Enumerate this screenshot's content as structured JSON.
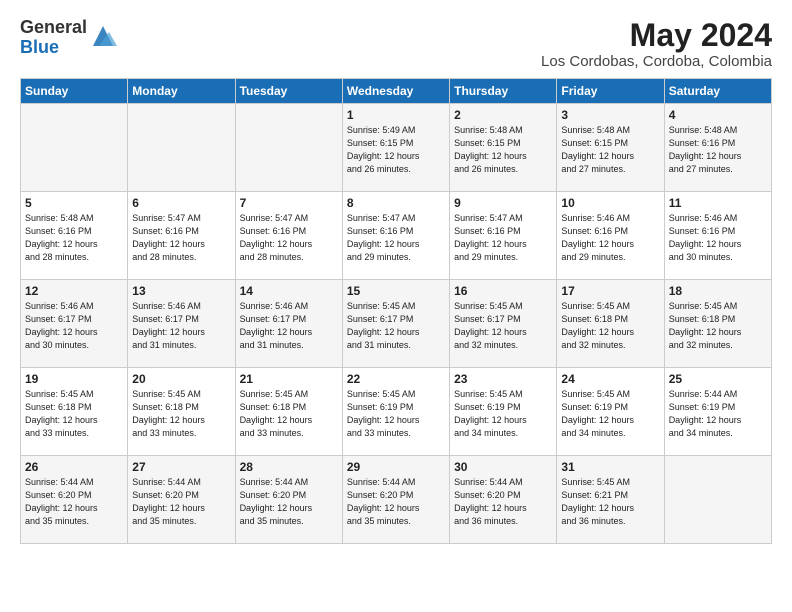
{
  "header": {
    "logo_general": "General",
    "logo_blue": "Blue",
    "month_year": "May 2024",
    "location": "Los Cordobas, Cordoba, Colombia"
  },
  "days_of_week": [
    "Sunday",
    "Monday",
    "Tuesday",
    "Wednesday",
    "Thursday",
    "Friday",
    "Saturday"
  ],
  "weeks": [
    [
      {
        "day": "",
        "info": ""
      },
      {
        "day": "",
        "info": ""
      },
      {
        "day": "",
        "info": ""
      },
      {
        "day": "1",
        "info": "Sunrise: 5:49 AM\nSunset: 6:15 PM\nDaylight: 12 hours\nand 26 minutes."
      },
      {
        "day": "2",
        "info": "Sunrise: 5:48 AM\nSunset: 6:15 PM\nDaylight: 12 hours\nand 26 minutes."
      },
      {
        "day": "3",
        "info": "Sunrise: 5:48 AM\nSunset: 6:15 PM\nDaylight: 12 hours\nand 27 minutes."
      },
      {
        "day": "4",
        "info": "Sunrise: 5:48 AM\nSunset: 6:16 PM\nDaylight: 12 hours\nand 27 minutes."
      }
    ],
    [
      {
        "day": "5",
        "info": "Sunrise: 5:48 AM\nSunset: 6:16 PM\nDaylight: 12 hours\nand 28 minutes."
      },
      {
        "day": "6",
        "info": "Sunrise: 5:47 AM\nSunset: 6:16 PM\nDaylight: 12 hours\nand 28 minutes."
      },
      {
        "day": "7",
        "info": "Sunrise: 5:47 AM\nSunset: 6:16 PM\nDaylight: 12 hours\nand 28 minutes."
      },
      {
        "day": "8",
        "info": "Sunrise: 5:47 AM\nSunset: 6:16 PM\nDaylight: 12 hours\nand 29 minutes."
      },
      {
        "day": "9",
        "info": "Sunrise: 5:47 AM\nSunset: 6:16 PM\nDaylight: 12 hours\nand 29 minutes."
      },
      {
        "day": "10",
        "info": "Sunrise: 5:46 AM\nSunset: 6:16 PM\nDaylight: 12 hours\nand 29 minutes."
      },
      {
        "day": "11",
        "info": "Sunrise: 5:46 AM\nSunset: 6:16 PM\nDaylight: 12 hours\nand 30 minutes."
      }
    ],
    [
      {
        "day": "12",
        "info": "Sunrise: 5:46 AM\nSunset: 6:17 PM\nDaylight: 12 hours\nand 30 minutes."
      },
      {
        "day": "13",
        "info": "Sunrise: 5:46 AM\nSunset: 6:17 PM\nDaylight: 12 hours\nand 31 minutes."
      },
      {
        "day": "14",
        "info": "Sunrise: 5:46 AM\nSunset: 6:17 PM\nDaylight: 12 hours\nand 31 minutes."
      },
      {
        "day": "15",
        "info": "Sunrise: 5:45 AM\nSunset: 6:17 PM\nDaylight: 12 hours\nand 31 minutes."
      },
      {
        "day": "16",
        "info": "Sunrise: 5:45 AM\nSunset: 6:17 PM\nDaylight: 12 hours\nand 32 minutes."
      },
      {
        "day": "17",
        "info": "Sunrise: 5:45 AM\nSunset: 6:18 PM\nDaylight: 12 hours\nand 32 minutes."
      },
      {
        "day": "18",
        "info": "Sunrise: 5:45 AM\nSunset: 6:18 PM\nDaylight: 12 hours\nand 32 minutes."
      }
    ],
    [
      {
        "day": "19",
        "info": "Sunrise: 5:45 AM\nSunset: 6:18 PM\nDaylight: 12 hours\nand 33 minutes."
      },
      {
        "day": "20",
        "info": "Sunrise: 5:45 AM\nSunset: 6:18 PM\nDaylight: 12 hours\nand 33 minutes."
      },
      {
        "day": "21",
        "info": "Sunrise: 5:45 AM\nSunset: 6:18 PM\nDaylight: 12 hours\nand 33 minutes."
      },
      {
        "day": "22",
        "info": "Sunrise: 5:45 AM\nSunset: 6:19 PM\nDaylight: 12 hours\nand 33 minutes."
      },
      {
        "day": "23",
        "info": "Sunrise: 5:45 AM\nSunset: 6:19 PM\nDaylight: 12 hours\nand 34 minutes."
      },
      {
        "day": "24",
        "info": "Sunrise: 5:45 AM\nSunset: 6:19 PM\nDaylight: 12 hours\nand 34 minutes."
      },
      {
        "day": "25",
        "info": "Sunrise: 5:44 AM\nSunset: 6:19 PM\nDaylight: 12 hours\nand 34 minutes."
      }
    ],
    [
      {
        "day": "26",
        "info": "Sunrise: 5:44 AM\nSunset: 6:20 PM\nDaylight: 12 hours\nand 35 minutes."
      },
      {
        "day": "27",
        "info": "Sunrise: 5:44 AM\nSunset: 6:20 PM\nDaylight: 12 hours\nand 35 minutes."
      },
      {
        "day": "28",
        "info": "Sunrise: 5:44 AM\nSunset: 6:20 PM\nDaylight: 12 hours\nand 35 minutes."
      },
      {
        "day": "29",
        "info": "Sunrise: 5:44 AM\nSunset: 6:20 PM\nDaylight: 12 hours\nand 35 minutes."
      },
      {
        "day": "30",
        "info": "Sunrise: 5:44 AM\nSunset: 6:20 PM\nDaylight: 12 hours\nand 36 minutes."
      },
      {
        "day": "31",
        "info": "Sunrise: 5:45 AM\nSunset: 6:21 PM\nDaylight: 12 hours\nand 36 minutes."
      },
      {
        "day": "",
        "info": ""
      }
    ]
  ]
}
